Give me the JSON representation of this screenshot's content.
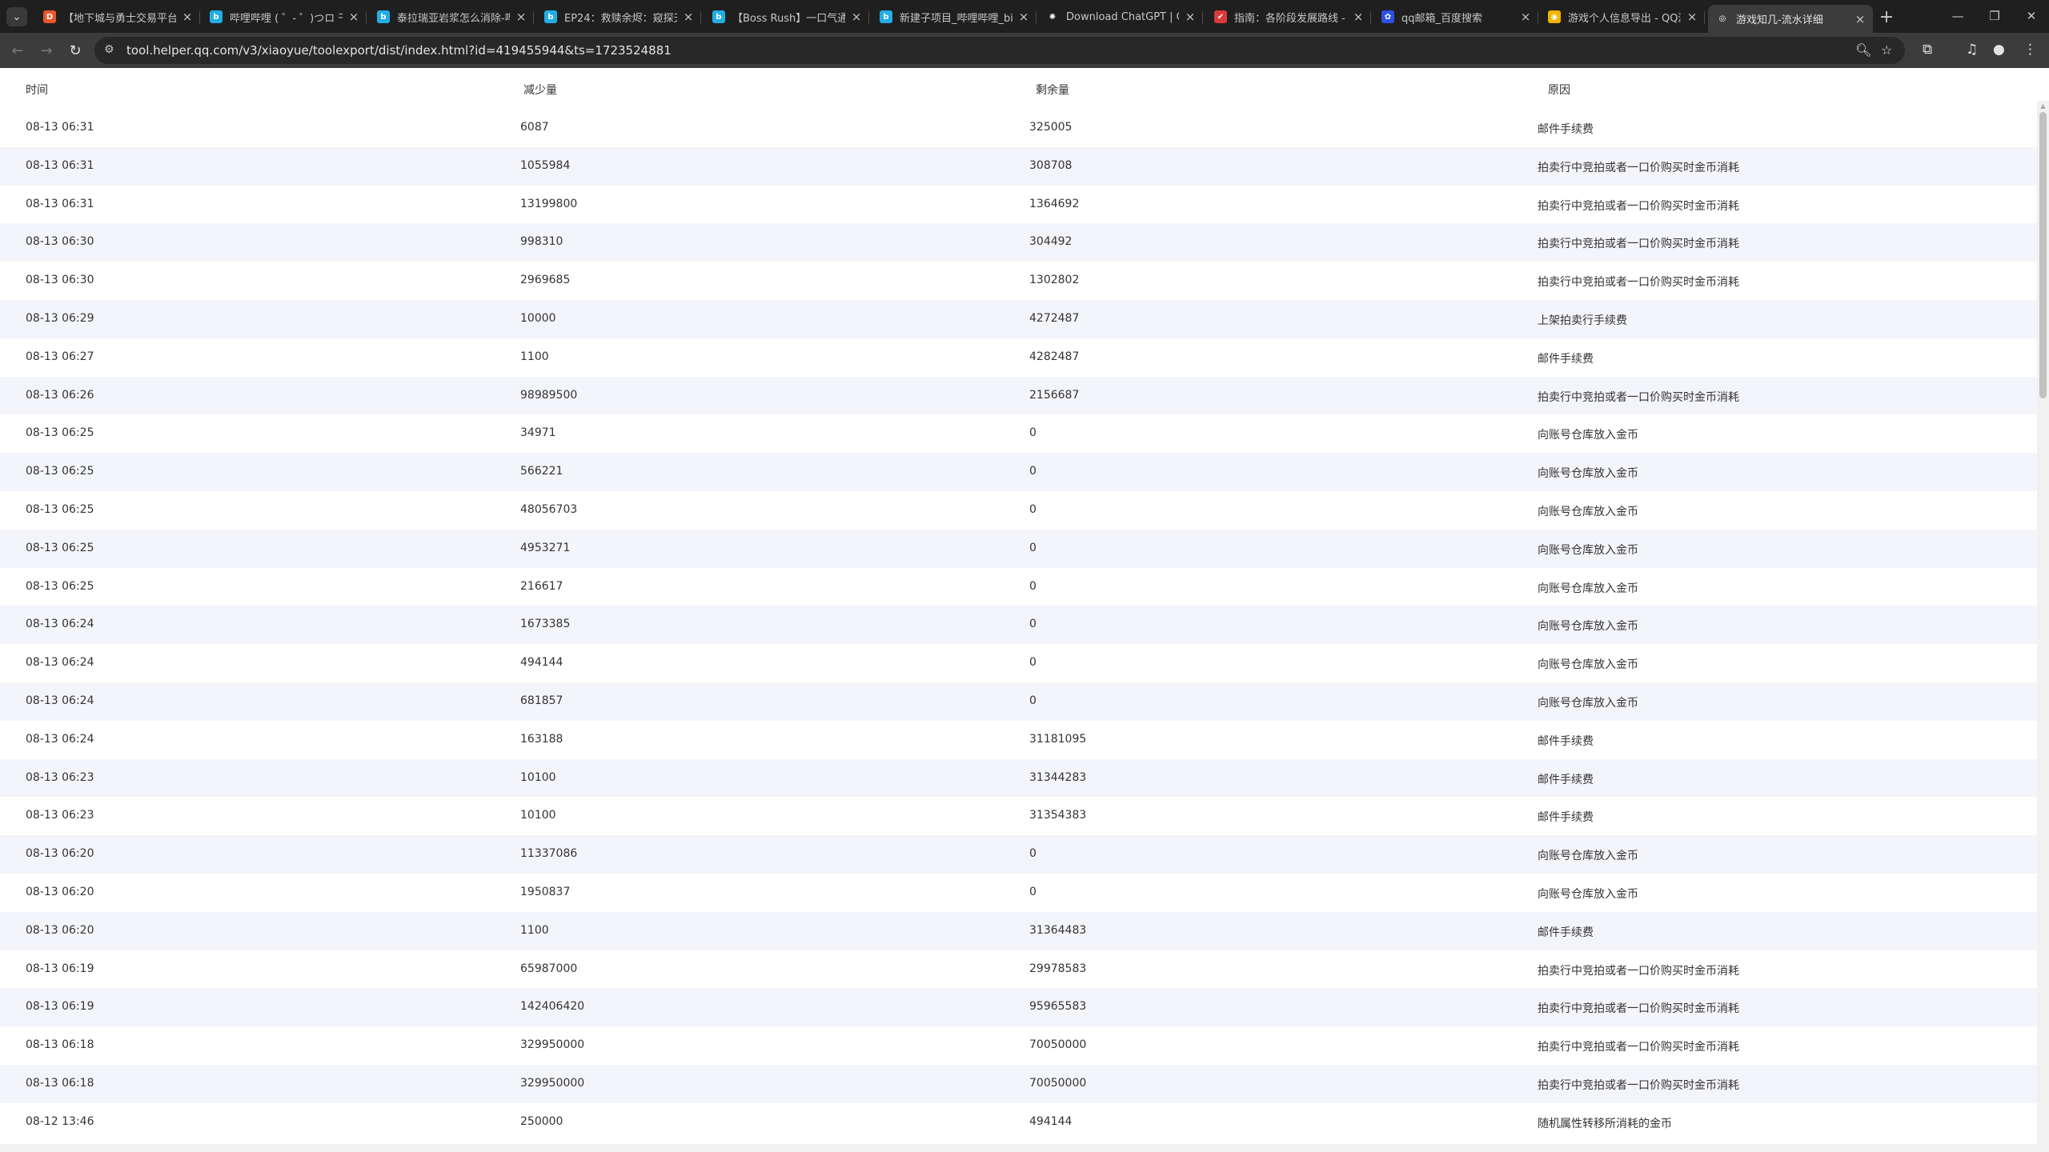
{
  "browser": {
    "tabs": [
      {
        "title": "【地下城与勇士交易平台】",
        "favicon": "dnf-icon",
        "color": "#e8572b",
        "glyph": "D"
      },
      {
        "title": "哔哩哔哩 ( ゜- ゜)つロ 干杯",
        "favicon": "bilibili-icon",
        "color": "#23ade5",
        "glyph": "b"
      },
      {
        "title": "泰拉瑞亚岩浆怎么消除-哔",
        "favicon": "bilibili-icon",
        "color": "#23ade5",
        "glyph": "b"
      },
      {
        "title": "EP24：救赎余烬：窥探天",
        "favicon": "bilibili-icon",
        "color": "#23ade5",
        "glyph": "b"
      },
      {
        "title": "【Boss Rush】一口气通",
        "favicon": "bilibili-icon",
        "color": "#23ade5",
        "glyph": "b"
      },
      {
        "title": "新建子项目_哔哩哔哩_bili",
        "favicon": "bilibili-icon",
        "color": "#23ade5",
        "glyph": "b"
      },
      {
        "title": "Download ChatGPT | Op",
        "favicon": "openai-icon",
        "color": "#1f1f1f",
        "glyph": "✺"
      },
      {
        "title": "指南：各阶段发展路线 -",
        "favicon": "guide-icon",
        "color": "#d93b3b",
        "glyph": "✔"
      },
      {
        "title": "qq邮箱_百度搜索",
        "favicon": "baidu-icon",
        "color": "#2d50e0",
        "glyph": "✿"
      },
      {
        "title": "游戏个人信息导出 - QQ浏",
        "favicon": "qq-browser-icon",
        "color": "#f0b400",
        "glyph": "◉"
      },
      {
        "title": "游戏知几-流水详细",
        "favicon": "globe-icon",
        "color": "#3c3c3c",
        "glyph": "◎",
        "active": true
      }
    ],
    "url": "tool.helper.qq.com/v3/xiaoyue/toolexport/dist/index.html?id=419455944&ts=1723524881"
  },
  "table": {
    "headers": [
      "时间",
      "减少量",
      "剩余量",
      "原因"
    ],
    "rows": [
      [
        "08-13 06:31",
        "6087",
        "325005",
        "邮件手续费"
      ],
      [
        "08-13 06:31",
        "1055984",
        "308708",
        "拍卖行中竞拍或者一口价购买时金币消耗"
      ],
      [
        "08-13 06:31",
        "13199800",
        "1364692",
        "拍卖行中竞拍或者一口价购买时金币消耗"
      ],
      [
        "08-13 06:30",
        "998310",
        "304492",
        "拍卖行中竞拍或者一口价购买时金币消耗"
      ],
      [
        "08-13 06:30",
        "2969685",
        "1302802",
        "拍卖行中竞拍或者一口价购买时金币消耗"
      ],
      [
        "08-13 06:29",
        "10000",
        "4272487",
        "上架拍卖行手续费"
      ],
      [
        "08-13 06:27",
        "1100",
        "4282487",
        "邮件手续费"
      ],
      [
        "08-13 06:26",
        "98989500",
        "2156687",
        "拍卖行中竞拍或者一口价购买时金币消耗"
      ],
      [
        "08-13 06:25",
        "34971",
        "0",
        "向账号仓库放入金币"
      ],
      [
        "08-13 06:25",
        "566221",
        "0",
        "向账号仓库放入金币"
      ],
      [
        "08-13 06:25",
        "48056703",
        "0",
        "向账号仓库放入金币"
      ],
      [
        "08-13 06:25",
        "4953271",
        "0",
        "向账号仓库放入金币"
      ],
      [
        "08-13 06:25",
        "216617",
        "0",
        "向账号仓库放入金币"
      ],
      [
        "08-13 06:24",
        "1673385",
        "0",
        "向账号仓库放入金币"
      ],
      [
        "08-13 06:24",
        "494144",
        "0",
        "向账号仓库放入金币"
      ],
      [
        "08-13 06:24",
        "681857",
        "0",
        "向账号仓库放入金币"
      ],
      [
        "08-13 06:24",
        "163188",
        "31181095",
        "邮件手续费"
      ],
      [
        "08-13 06:23",
        "10100",
        "31344283",
        "邮件手续费"
      ],
      [
        "08-13 06:23",
        "10100",
        "31354383",
        "邮件手续费"
      ],
      [
        "08-13 06:20",
        "11337086",
        "0",
        "向账号仓库放入金币"
      ],
      [
        "08-13 06:20",
        "1950837",
        "0",
        "向账号仓库放入金币"
      ],
      [
        "08-13 06:20",
        "1100",
        "31364483",
        "邮件手续费"
      ],
      [
        "08-13 06:19",
        "65987000",
        "29978583",
        "拍卖行中竞拍或者一口价购买时金币消耗"
      ],
      [
        "08-13 06:19",
        "142406420",
        "95965583",
        "拍卖行中竞拍或者一口价购买时金币消耗"
      ],
      [
        "08-13 06:18",
        "329950000",
        "70050000",
        "拍卖行中竞拍或者一口价购买时金币消耗"
      ],
      [
        "08-13 06:18",
        "329950000",
        "70050000",
        "拍卖行中竞拍或者一口价购买时金币消耗"
      ],
      [
        "08-12 13:46",
        "250000",
        "494144",
        "随机属性转移所消耗的金币"
      ]
    ]
  }
}
